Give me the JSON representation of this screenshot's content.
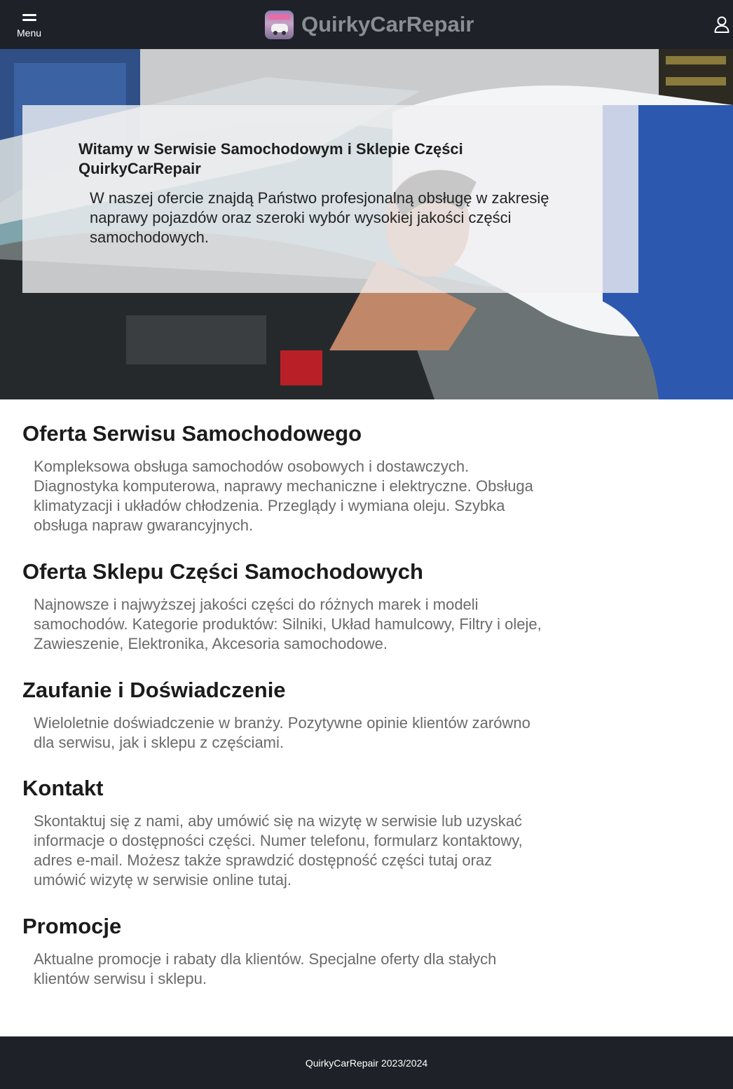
{
  "header": {
    "menu_label": "Menu",
    "brand_name": "QuirkyCarRepair"
  },
  "hero": {
    "title": "Witamy w Serwisie Samochodowym i Sklepie Części QuirkyCarRepair",
    "text": "W naszej ofercie znajdą Państwo profesjonalną obsługę w zakresię naprawy pojazdów oraz szeroki wybór wysokiej jakości części samochodowych."
  },
  "sections": [
    {
      "title": "Oferta Serwisu Samochodowego",
      "text": "Kompleksowa obsługa samochodów osobowych i dostawczych. Diagnostyka komputerowa, naprawy mechaniczne i elektryczne. Obsługa klimatyzacji i układów chłodzenia. Przeglądy i wymiana oleju. Szybka obsługa napraw gwarancyjnych."
    },
    {
      "title": "Oferta Sklepu Części Samochodowych",
      "text": "Najnowsze i najwyższej jakości części do różnych marek i modeli samochodów. Kategorie produktów: Silniki, Układ hamulcowy, Filtry i oleje, Zawieszenie, Elektronika, Akcesoria samochodowe."
    },
    {
      "title": "Zaufanie i Doświadczenie",
      "text": "Wieloletnie doświadczenie w branży. Pozytywne opinie klientów zarówno dla serwisu, jak i sklepu z częściami."
    },
    {
      "title": "Kontakt",
      "text": "Skontaktuj się z nami, aby umówić się na wizytę w serwisie lub uzyskać informacje o dostępności części. Numer telefonu, formularz kontaktowy, adres e-mail. Możesz także sprawdzić dostępność części tutaj oraz umówić wizytę w serwisie online tutaj."
    },
    {
      "title": "Promocje",
      "text": "Aktualne promocje i rabaty dla klientów. Specjalne oferty dla stałych klientów serwisu i sklepu."
    }
  ],
  "footer": {
    "text": "QuirkyCarRepair 2023/2024"
  },
  "icons": {
    "menu": "hamburger-menu-icon",
    "user": "user-account-icon",
    "logo": "car-shop-logo"
  },
  "colors": {
    "header_bg": "#1e2228",
    "brand_text": "#8a8d93",
    "section_heading": "#1b1b1b",
    "body_text": "#6a6a6a"
  }
}
